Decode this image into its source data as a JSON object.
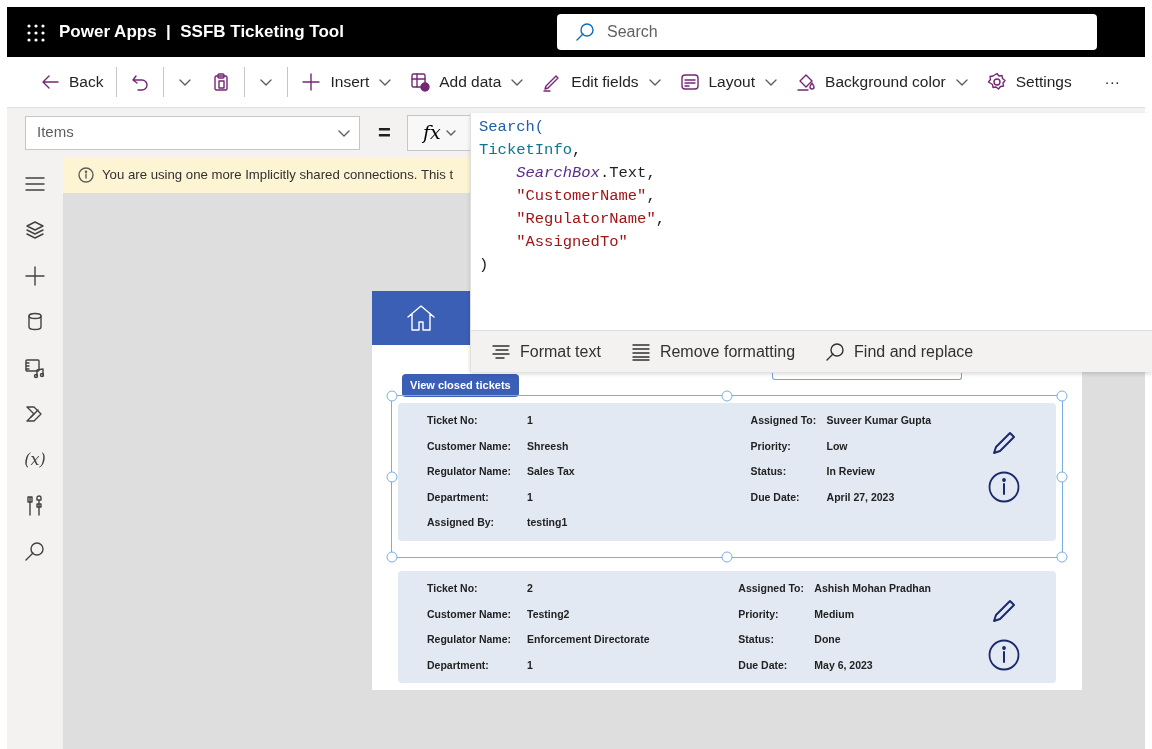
{
  "app_bar": {
    "title": "Power Apps  |  SSFB Ticketing Tool",
    "search": {
      "placeholder": "Search"
    }
  },
  "toolbar": [
    {
      "kind": "back",
      "label": "Back"
    },
    {
      "kind": "divider"
    },
    {
      "kind": "undo"
    },
    {
      "kind": "divider"
    },
    {
      "kind": "dropdown"
    },
    {
      "kind": "paste"
    },
    {
      "kind": "divider"
    },
    {
      "kind": "dropdown"
    },
    {
      "kind": "divider"
    },
    {
      "kind": "insert",
      "label": "Insert",
      "menu": true
    },
    {
      "kind": "add_data",
      "label": "Add data",
      "menu": true
    },
    {
      "kind": "edit_fields",
      "label": "Edit fields",
      "menu": true
    },
    {
      "kind": "layout",
      "label": "Layout",
      "menu": true
    },
    {
      "kind": "background",
      "label": "Background color",
      "menu": true
    },
    {
      "kind": "settings",
      "label": "Settings",
      "menu": false
    },
    {
      "kind": "more",
      "label": "···"
    }
  ],
  "formula_bar": {
    "property": "Items",
    "equals": "=",
    "fx": "fx",
    "code_lines": [
      {
        "tokens": [
          {
            "kind": "function",
            "text": "Search("
          }
        ]
      },
      {
        "tokens": [
          {
            "kind": "source",
            "text": "TicketInfo"
          },
          {
            "kind": "plain",
            "text": ","
          }
        ]
      },
      {
        "children": [
          {
            "tokens": [
              {
                "kind": "control",
                "text": "SearchBox"
              },
              {
                "kind": "plain",
                "text": ".Text,"
              }
            ]
          },
          {
            "tokens": [
              {
                "kind": "string",
                "text": "\"CustomerName\""
              },
              {
                "kind": "plain",
                "text": ","
              }
            ]
          },
          {
            "tokens": [
              {
                "kind": "string",
                "text": "\"RegulatorName\""
              },
              {
                "kind": "plain",
                "text": ","
              }
            ]
          },
          {
            "tokens": [
              {
                "kind": "string",
                "text": "\"AssignedTo\""
              }
            ]
          }
        ]
      },
      {
        "tokens": [
          {
            "kind": "plain",
            "text": ")"
          }
        ]
      }
    ],
    "actions": [
      {
        "kind": "format",
        "label": "Format text"
      },
      {
        "kind": "clear",
        "label": "Remove formatting"
      },
      {
        "kind": "find",
        "label": "Find and replace"
      }
    ]
  },
  "left_rail": [
    {
      "kind": "menu"
    },
    {
      "kind": "layers"
    },
    {
      "kind": "insert"
    },
    {
      "kind": "data"
    },
    {
      "kind": "media"
    },
    {
      "kind": "automate"
    },
    {
      "kind": "variables",
      "label": "(x)"
    },
    {
      "kind": "tools"
    },
    {
      "kind": "search"
    }
  ],
  "banner": {
    "text": "You are using one more Implicitly shared connections. This t"
  },
  "canvas": {
    "button": "View closed tickets",
    "tickets": [
      {
        "selected": true,
        "left": [
          {
            "label": "Ticket No:",
            "value": "1"
          },
          {
            "label": "Customer Name:",
            "value": "Shreesh"
          },
          {
            "label": "Regulator Name:",
            "value": "Sales Tax"
          },
          {
            "label": "Department:",
            "value": "1"
          },
          {
            "label": "Assigned By:",
            "value": "testing1"
          }
        ],
        "right": [
          {
            "label": "Assigned To:",
            "value": "Suveer Kumar Gupta"
          },
          {
            "label": "Priority:",
            "value": "Low"
          },
          {
            "label": "Status:",
            "value": "In Review"
          },
          {
            "label": "Due Date:",
            "value": "April 27, 2023"
          }
        ]
      },
      {
        "selected": false,
        "left": [
          {
            "label": "Ticket No:",
            "value": "2"
          },
          {
            "label": "Customer Name:",
            "value": "Testing2"
          },
          {
            "label": "Regulator Name:",
            "value": "Enforcement Directorate"
          },
          {
            "label": "Department:",
            "value": "1"
          }
        ],
        "right": [
          {
            "label": "Assigned To:",
            "value": "Ashish Mohan Pradhan"
          },
          {
            "label": "Priority:",
            "value": "Medium"
          },
          {
            "label": "Status:",
            "value": "Done"
          },
          {
            "label": "Due Date:",
            "value": "May 6, 2023"
          }
        ]
      }
    ]
  }
}
